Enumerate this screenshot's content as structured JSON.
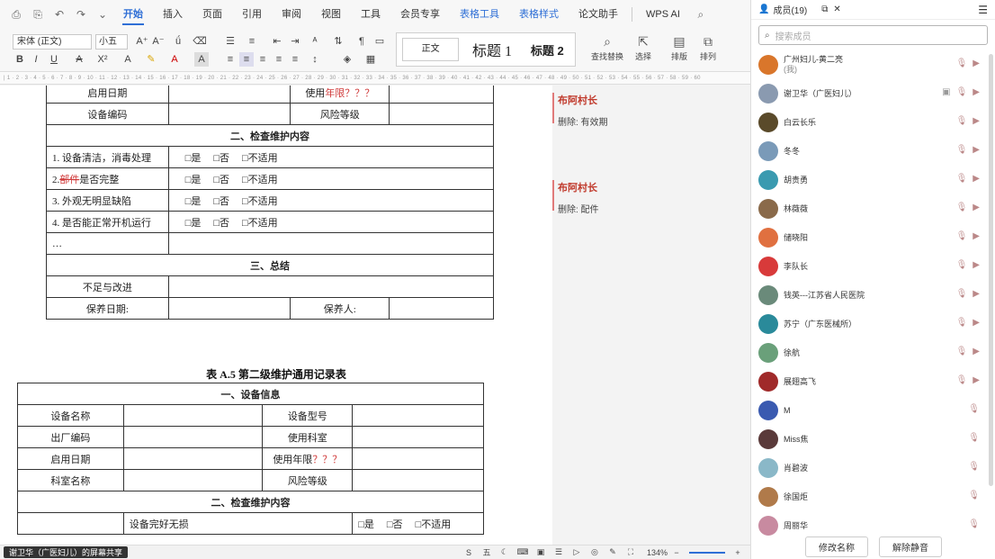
{
  "menubar": {
    "tabs": [
      "开始",
      "插入",
      "页面",
      "引用",
      "审阅",
      "视图",
      "工具",
      "会员专享",
      "表格工具",
      "表格样式",
      "论文助手",
      "WPS AI"
    ]
  },
  "ribbon": {
    "font": "宋体 (正文)",
    "size": "小五",
    "styles": [
      "正文",
      "标题 1",
      "标题 2"
    ],
    "tools": [
      "查找替换",
      "选择",
      "排版",
      "排列"
    ]
  },
  "ruler_text": "| 1 · 2 · 3 · 4 · 5 · 6 · 7 · 8 · 9 · 10 · 11 · 12 · 13 · 14 · 15 · 16 · 17 · 18 · 19 · 20 · 21 · 22 · 23 · 24 · 25 · 26 · 27 · 28 · 29 · 30 · 31 · 32 · 33 · 34 · 35 · 36 · 37 · 38 · 39 · 40 · 41 · 42 · 43 · 44 · 45 · 46 · 47 · 48 · 49 · 50 · 51 · 52 · 53 · 54 · 55 · 56 · 57 · 58 · 59 · 60",
  "table1": {
    "row_enable": {
      "label": "启用日期",
      "use_label": "使用",
      "use_red": "年限？？？"
    },
    "row_code": {
      "label": "设备编码",
      "risk": "风险等级"
    },
    "section2": "二、检查维护内容",
    "items": [
      {
        "num": "1. ",
        "text": "设备清洁，消毒处理",
        "red": ""
      },
      {
        "num": "2.",
        "text": "是否完整",
        "red": "部件"
      },
      {
        "num": "3. ",
        "text": "外观无明显缺陷",
        "red": ""
      },
      {
        "num": "4. ",
        "text": "是否能正常开机运行",
        "red": ""
      }
    ],
    "checks": [
      "□是",
      "□否",
      "□不适用"
    ],
    "ellipsis": "…",
    "section3": "三、总结",
    "improve": "不足与改进",
    "date": "保养日期:",
    "person": "保养人:"
  },
  "table2": {
    "title": "表 A.5 第二级维护通用记录表",
    "section1": "一、设备信息",
    "name": "设备名称",
    "model": "设备型号",
    "factory": "出厂编码",
    "dept_use": "使用科室",
    "enable": "启用日期",
    "years_label": "使用年限",
    "years_red": "？？？",
    "dept": "科室名称",
    "risk": "风险等级",
    "section2": "二、检查维护内容",
    "item1": "设备完好无损",
    "checks": [
      "□是",
      "□否",
      "□不适用"
    ]
  },
  "comments": [
    {
      "author": "布阿村长",
      "text": "删除: 有效期"
    },
    {
      "author": "布阿村长",
      "text": "删除: 配件"
    }
  ],
  "status": {
    "left": "谢卫华（广医妇儿）的屏幕共享",
    "zoom": "134%",
    "ime": "五"
  },
  "panel": {
    "members_tab": "成员(19)",
    "search_placeholder": "搜索成员",
    "members": [
      {
        "name": "广州妇儿-黄二亮",
        "sub": "(我)",
        "color": "#d9762b"
      },
      {
        "name": "谢卫华（广医妇儿）",
        "sub": "",
        "color": "#8a9ab0"
      },
      {
        "name": "白云长乐",
        "sub": "",
        "color": "#5a4a2a"
      },
      {
        "name": "冬冬",
        "sub": "",
        "color": "#7a9ab8"
      },
      {
        "name": "胡贵勇",
        "sub": "",
        "color": "#3a9ab0"
      },
      {
        "name": "林薇薇",
        "sub": "",
        "color": "#8a6a4a"
      },
      {
        "name": "储晓阳",
        "sub": "",
        "color": "#e07040"
      },
      {
        "name": "李队长",
        "sub": "",
        "color": "#d83a3a"
      },
      {
        "name": "钱英---江苏省人民医院",
        "sub": "",
        "color": "#6a8a7a"
      },
      {
        "name": "苏宁（广东医械所）",
        "sub": "",
        "color": "#2a8a9a"
      },
      {
        "name": "徐航",
        "sub": "",
        "color": "#6aa07a"
      },
      {
        "name": "展翅高飞",
        "sub": "",
        "color": "#a02a2a"
      },
      {
        "name": "M",
        "sub": "",
        "color": "#3a5ab0"
      },
      {
        "name": "Miss焦",
        "sub": "",
        "color": "#5a3a3a"
      },
      {
        "name": "肖碧波",
        "sub": "",
        "color": "#8ab8c8"
      },
      {
        "name": "徐国炬",
        "sub": "",
        "color": "#b07a4a"
      },
      {
        "name": "周丽华",
        "sub": "",
        "color": "#c88aa0"
      }
    ],
    "rename": "修改名称",
    "unmute": "解除静音"
  }
}
